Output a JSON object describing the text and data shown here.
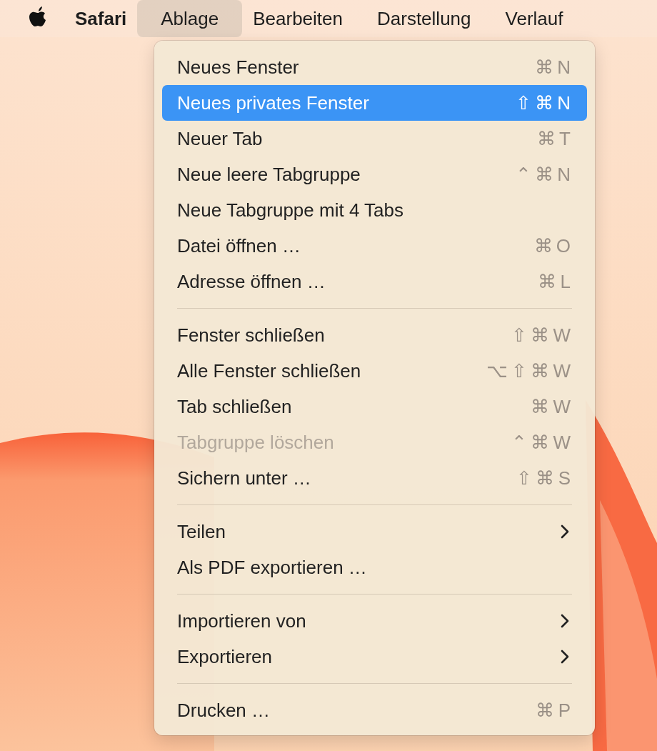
{
  "menu_bar": {
    "items": [
      {
        "label": "Safari",
        "kind": "app",
        "selected": false
      },
      {
        "label": "Ablage",
        "kind": "menu",
        "selected": true
      },
      {
        "label": "Bearbeiten",
        "kind": "menu",
        "selected": false
      },
      {
        "label": "Darstellung",
        "kind": "menu",
        "selected": false
      },
      {
        "label": "Verlauf",
        "kind": "menu",
        "selected": false
      }
    ]
  },
  "menu": {
    "items": [
      {
        "kind": "item",
        "label": "Neues Fenster",
        "shortcut": "⌘ N",
        "selected": false,
        "disabled": false
      },
      {
        "kind": "item",
        "label": "Neues privates Fenster",
        "shortcut": "⇧ ⌘ N",
        "selected": true,
        "disabled": false
      },
      {
        "kind": "item",
        "label": "Neuer Tab",
        "shortcut": "⌘ T",
        "selected": false,
        "disabled": false
      },
      {
        "kind": "item",
        "label": "Neue leere Tabgruppe",
        "shortcut": "⌃ ⌘ N",
        "selected": false,
        "disabled": false
      },
      {
        "kind": "item",
        "label": "Neue Tabgruppe mit 4 Tabs",
        "selected": false,
        "disabled": false
      },
      {
        "kind": "item",
        "label": "Datei öffnen …",
        "shortcut": "⌘ O",
        "selected": false,
        "disabled": false
      },
      {
        "kind": "item",
        "label": "Adresse öffnen …",
        "shortcut": "⌘ L",
        "selected": false,
        "disabled": false
      },
      {
        "kind": "separator"
      },
      {
        "kind": "item",
        "label": "Fenster schließen",
        "shortcut": "⇧ ⌘ W",
        "selected": false,
        "disabled": false
      },
      {
        "kind": "item",
        "label": "Alle Fenster schließen",
        "shortcut": "⌥ ⇧ ⌘ W",
        "selected": false,
        "disabled": false
      },
      {
        "kind": "item",
        "label": "Tab schließen",
        "shortcut": "⌘ W",
        "selected": false,
        "disabled": false
      },
      {
        "kind": "item",
        "label": "Tabgruppe löschen",
        "shortcut": "⌃ ⌘ W",
        "selected": false,
        "disabled": true
      },
      {
        "kind": "item",
        "label": "Sichern unter …",
        "shortcut": "⇧ ⌘ S",
        "selected": false,
        "disabled": false
      },
      {
        "kind": "separator"
      },
      {
        "kind": "submenu",
        "label": "Teilen",
        "selected": false,
        "disabled": false
      },
      {
        "kind": "item",
        "label": "Als PDF exportieren …",
        "selected": false,
        "disabled": false
      },
      {
        "kind": "separator"
      },
      {
        "kind": "submenu",
        "label": "Importieren von",
        "selected": false,
        "disabled": false
      },
      {
        "kind": "submenu",
        "label": "Exportieren",
        "selected": false,
        "disabled": false
      },
      {
        "kind": "separator"
      },
      {
        "kind": "item",
        "label": "Drucken …",
        "shortcut": "⌘ P",
        "selected": false,
        "disabled": false
      }
    ]
  }
}
